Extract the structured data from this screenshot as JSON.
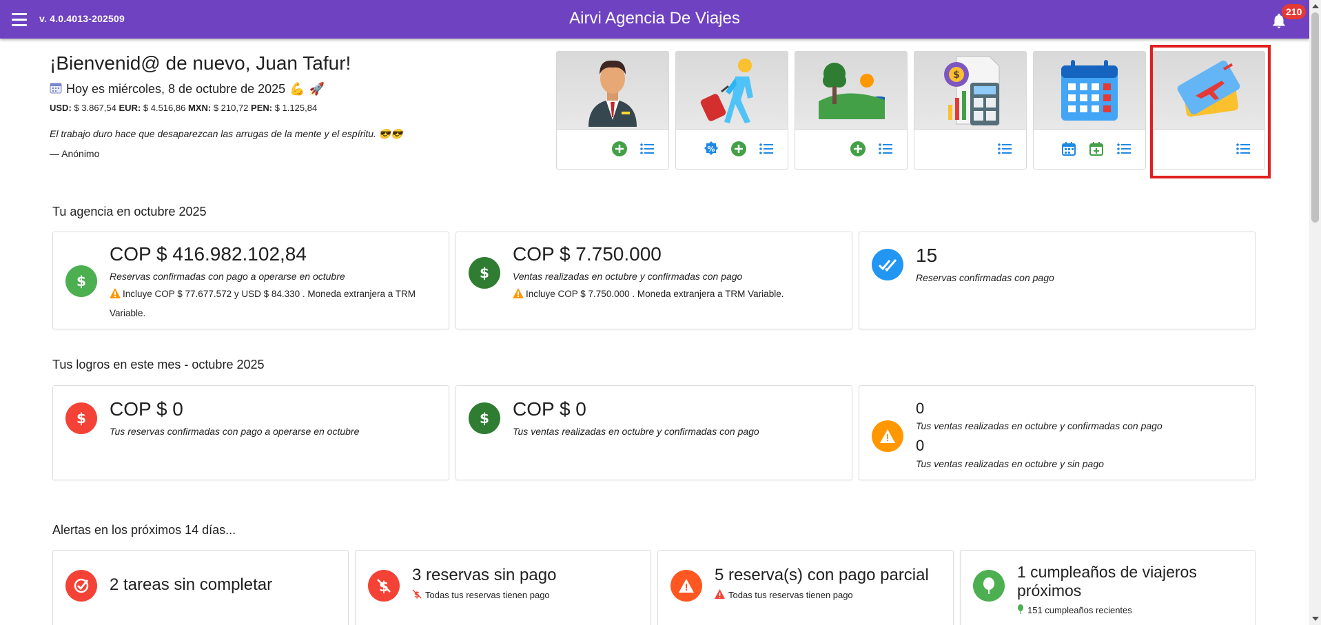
{
  "header": {
    "version": "v. 4.0.4013-202509",
    "title": "Airvi Agencia De Viajes",
    "notifications_count": "210",
    "color": "#6f42c1"
  },
  "welcome": {
    "greeting": "¡Bienvenid@ de nuevo, Juan Tafur!",
    "today": "Hoy es miércoles, 8 de octubre de 2025",
    "rates": [
      {
        "label": "USD:",
        "value": "$ 3.867,54"
      },
      {
        "label": "EUR:",
        "value": "$ 4.516,86"
      },
      {
        "label": "MXN:",
        "value": "$ 210,72"
      },
      {
        "label": "PEN:",
        "value": "$ 1.125,84"
      }
    ],
    "quote": "El trabajo duro hace que desaparezcan las arrugas de la mente y el espíritu. 😎😎",
    "author": "— Anónimo"
  },
  "tiles": [
    {
      "name": "clients",
      "icon": "agent-icon",
      "actions": [
        "add-icon",
        "list-icon"
      ]
    },
    {
      "name": "travelers",
      "icon": "traveler-icon",
      "actions": [
        "discount-icon",
        "add-icon",
        "list-icon"
      ]
    },
    {
      "name": "destinations",
      "icon": "landscape-icon",
      "actions": [
        "add-icon",
        "list-icon"
      ]
    },
    {
      "name": "accounting",
      "icon": "calculator-icon",
      "actions": [
        "list-icon"
      ]
    },
    {
      "name": "calendar",
      "icon": "calendar-icon",
      "actions": [
        "calendar-view-icon",
        "calendar-add-icon",
        "list-icon"
      ]
    },
    {
      "name": "tickets",
      "icon": "ticket-icon",
      "actions": [
        "list-icon"
      ]
    }
  ],
  "agency": {
    "title": "Tu agencia en octubre 2025",
    "cards": [
      {
        "amount": "COP $ 416.982.102,84",
        "desc": "Reservas confirmadas con pago a operarse en octubre",
        "note": "Incluye COP $ 77.677.572 y USD $ 84.330 . Moneda extranjera a TRM Variable."
      },
      {
        "amount": "COP $ 7.750.000",
        "desc": "Ventas realizadas en octubre y confirmadas con pago",
        "note": "Incluye COP $ 7.750.000 . Moneda extranjera a TRM Variable."
      },
      {
        "amount": "15",
        "desc": "Reservas confirmadas con pago"
      }
    ]
  },
  "achievements": {
    "title": "Tus logros en este mes - octubre 2025",
    "cards": [
      {
        "amount": "COP $ 0",
        "desc": "Tus reservas confirmadas con pago a operarse en octubre"
      },
      {
        "amount": "COP $ 0",
        "desc": "Tus ventas realizadas en octubre y confirmadas con pago"
      },
      {
        "count1": "0",
        "desc1": "Tus ventas realizadas en octubre y confirmadas con pago",
        "count2": "0",
        "desc2": "Tus ventas realizadas en octubre y sin pago"
      }
    ]
  },
  "alerts": {
    "title": "Alertas en los próximos 14 días...",
    "cards": [
      {
        "title": "2 tareas sin completar",
        "sub": ""
      },
      {
        "title": "3 reservas sin pago",
        "sub": "Todas tus reservas tienen pago"
      },
      {
        "title": "5 reserva(s) con pago parcial",
        "sub": "Todas tus reservas tienen pago"
      },
      {
        "title": "1 cumpleaños de viajeros próximos",
        "sub": "151 cumpleaños recientes"
      }
    ]
  },
  "colors": {
    "green": "#4caf50",
    "dark_green": "#2e7d32",
    "blue": "#2196f3",
    "red": "#f44336",
    "orange": "#ff9800",
    "deep_orange": "#ff5722",
    "icon_blue": "#1e88e5"
  }
}
